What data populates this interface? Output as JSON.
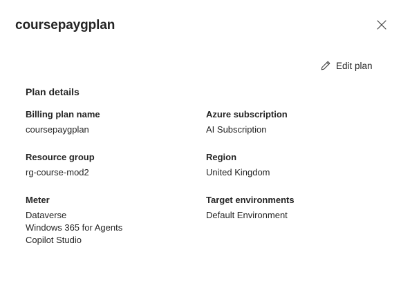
{
  "panel": {
    "title": "coursepaygplan",
    "close_icon": "close-icon",
    "edit_plan_label": "Edit plan",
    "edit_icon": "pencil-icon"
  },
  "details": {
    "heading": "Plan details",
    "billing_plan_name": {
      "label": "Billing plan name",
      "value": "coursepaygplan"
    },
    "azure_subscription": {
      "label": "Azure subscription",
      "value": "AI Subscription"
    },
    "resource_group": {
      "label": "Resource group",
      "value": "rg-course-mod2"
    },
    "region": {
      "label": "Region",
      "value": "United Kingdom"
    },
    "meter": {
      "label": "Meter",
      "values": [
        "Dataverse",
        "Windows 365 for Agents",
        "Copilot Studio"
      ]
    },
    "target_environments": {
      "label": "Target environments",
      "value": "Default Environment"
    }
  }
}
